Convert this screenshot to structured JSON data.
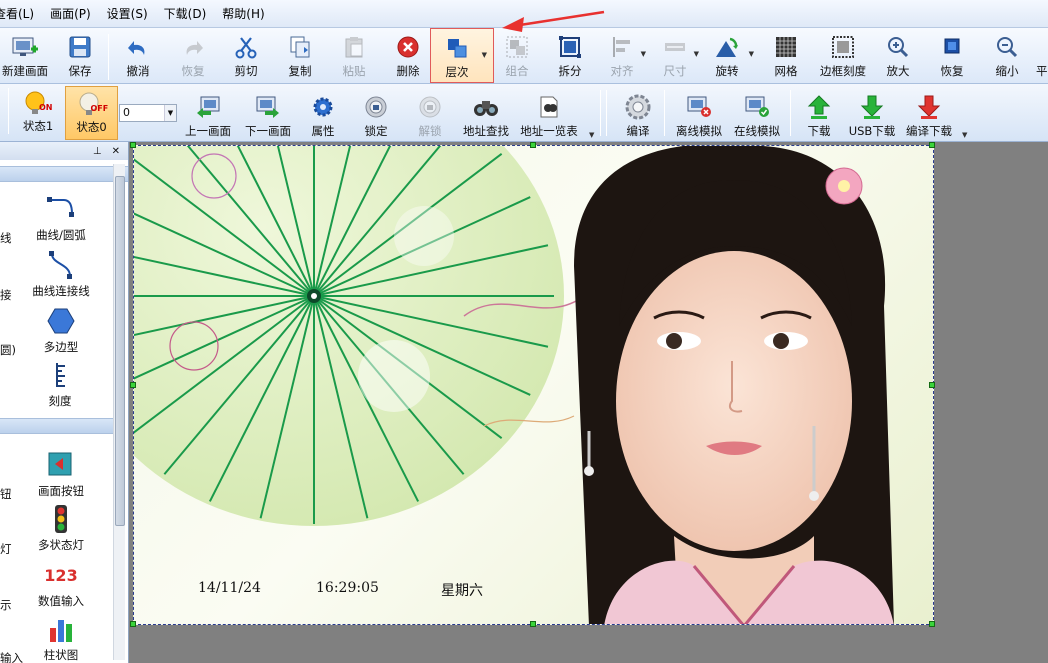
{
  "menu": [
    "查看(L)",
    "画面(P)",
    "设置(S)",
    "下载(D)",
    "帮助(H)"
  ],
  "toolbar": {
    "new_screen": "新建画面",
    "save": "保存",
    "undo": "撤消",
    "redo": "恢复",
    "cut": "剪切",
    "copy": "复制",
    "paste": "粘贴",
    "delete": "删除",
    "layer": "层次",
    "group": "组合",
    "ungroup": "拆分",
    "align": "对齐",
    "size": "尺寸",
    "rotate": "旋转",
    "grid": "网格",
    "border_scale": "边框刻度",
    "zoom_in": "放大",
    "restore": "恢复",
    "zoom_out": "缩小",
    "flat": "平"
  },
  "toolbar2": {
    "state1": "状态1",
    "state0": "状态0",
    "state_value": "0",
    "prev_screen": "上一画面",
    "next_screen": "下一画面",
    "properties": "属性",
    "lock": "锁定",
    "unlock": "解锁",
    "address_find": "地址查找",
    "address_list": "地址一览表",
    "compile": "编译",
    "offline_sim": "离线模拟",
    "online_sim": "在线模拟",
    "download": "下载",
    "usb_download": "USB下载",
    "compile_download": "编译下载",
    "on_badge": "ON",
    "off_badge": "OFF"
  },
  "panel": {
    "pin": "⊥",
    "close": "✕",
    "tools": {
      "curve_arc": "曲线/圆弧",
      "curve_connect": "曲线连接线",
      "polygon": "多边型",
      "scale": "刻度",
      "screen_button": "画面按钮",
      "multi_state_lamp": "多状态灯",
      "numeric_input": "数值输入",
      "bar_chart": "柱状图",
      "partial1": "线",
      "partial2": "接",
      "partial3": "圆)",
      "partial4": "钮",
      "partial5": "灯",
      "partial6": "示",
      "partial7": "输入",
      "numeric_icon_text": "123"
    }
  },
  "canvas": {
    "date": "14/11/24",
    "time": "16:29:05",
    "weekday": "星期六"
  },
  "colors": {
    "highlight_border": "#e05a5a",
    "arrow": "#e8312f",
    "handle": "#3bd43b"
  }
}
